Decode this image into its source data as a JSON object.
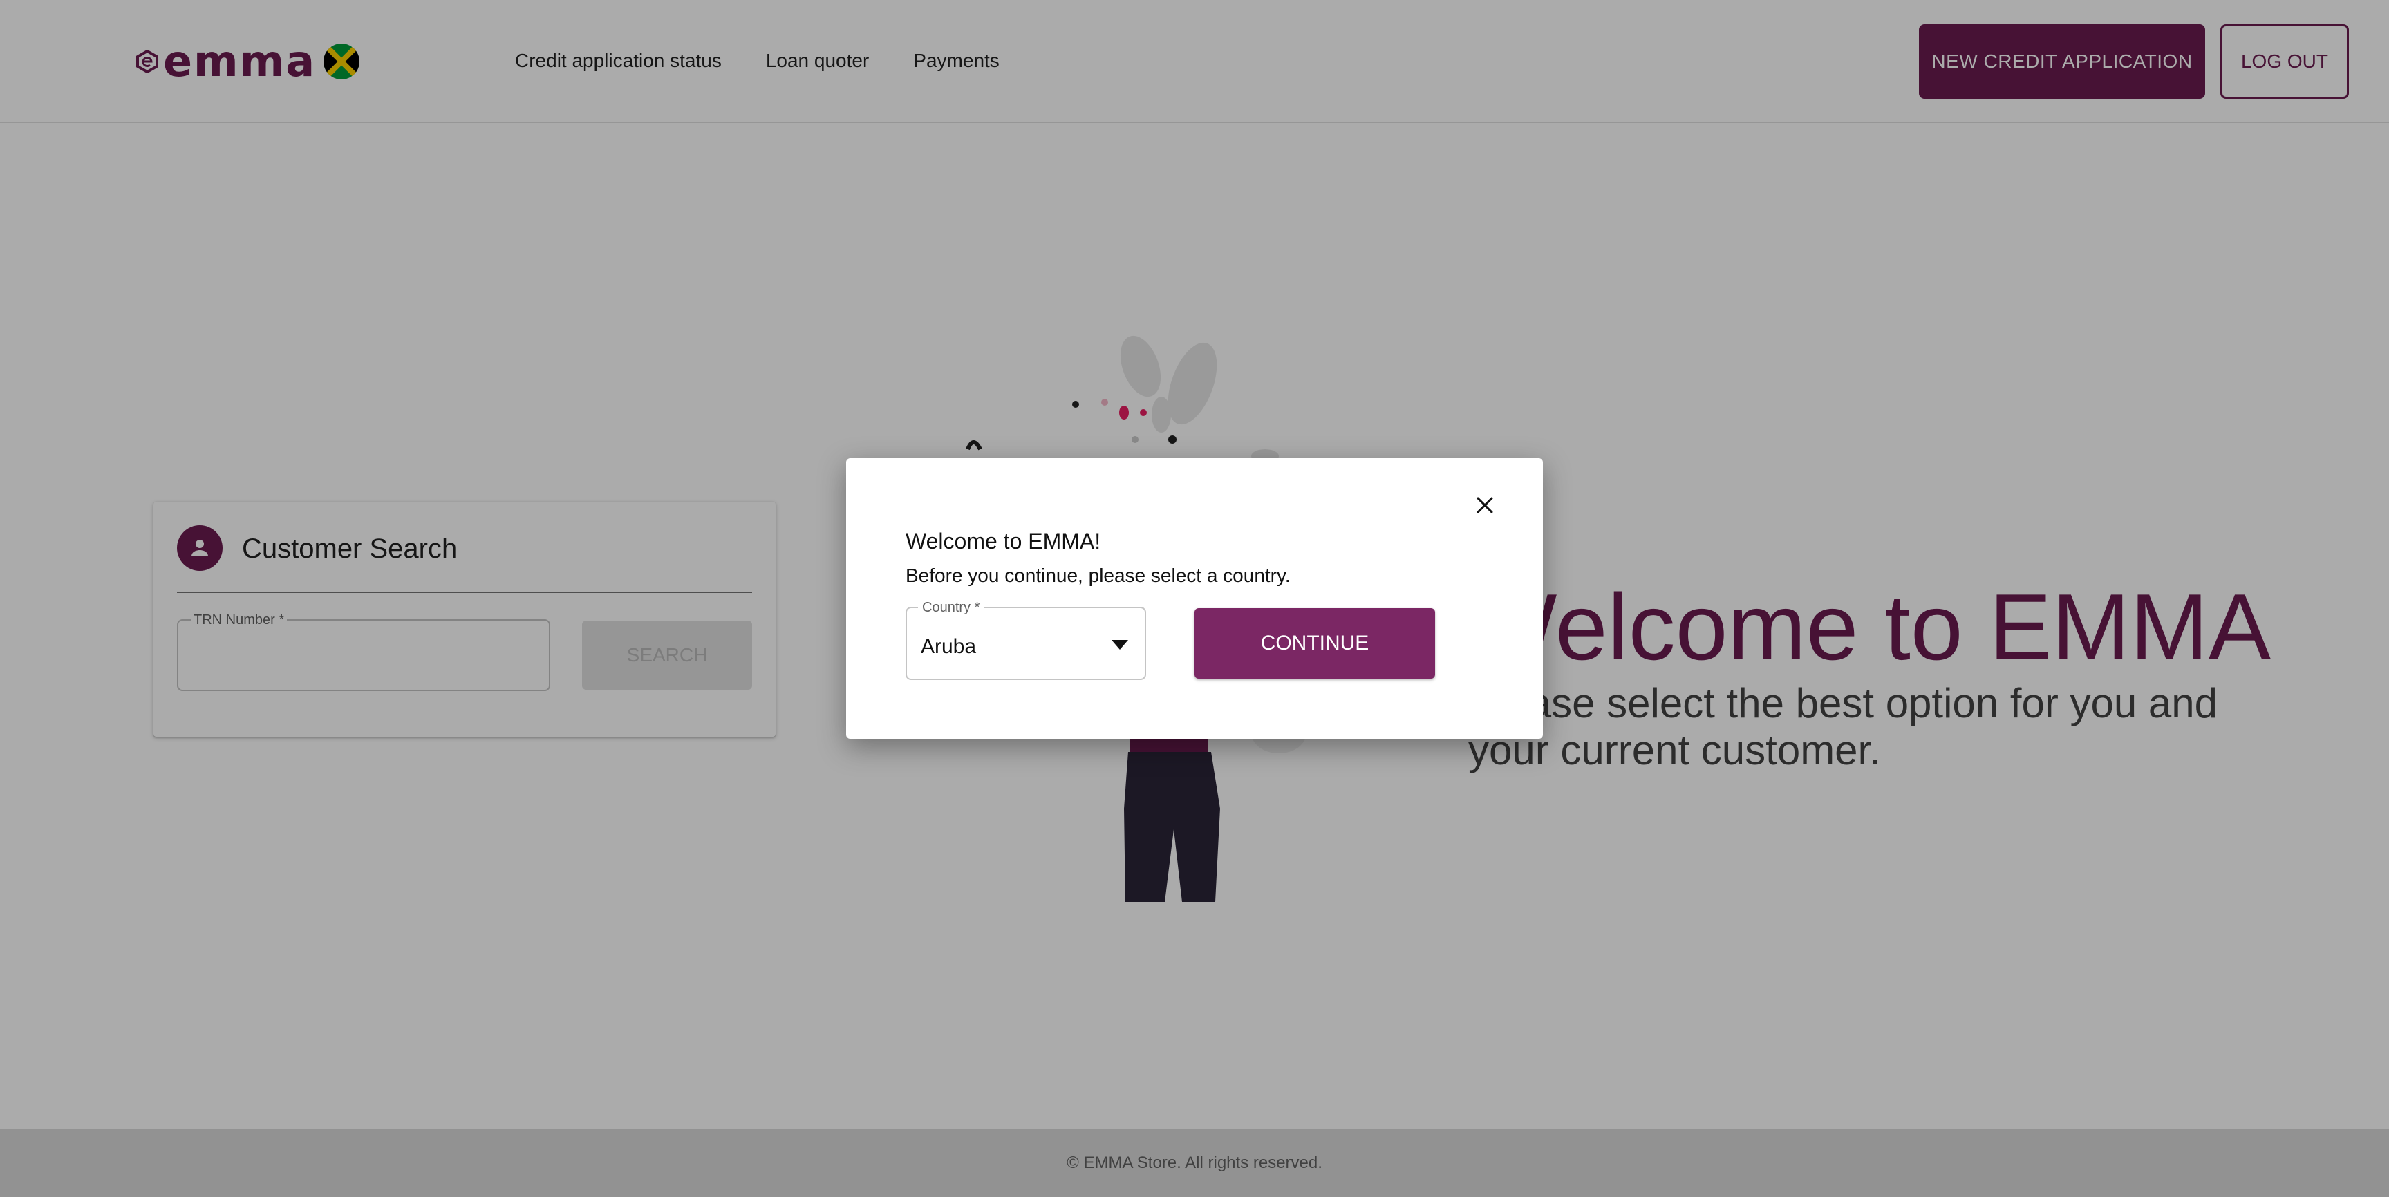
{
  "header": {
    "logo_text": "emma",
    "flag_icon": "jamaica-flag-icon",
    "nav": [
      {
        "label": "Credit application status"
      },
      {
        "label": "Loan quoter"
      },
      {
        "label": "Payments"
      }
    ],
    "new_application_label": "NEW CREDIT APPLICATION",
    "logout_label": "LOG OUT"
  },
  "search": {
    "title": "Customer Search",
    "avatar_icon": "person-icon",
    "trn_label": "TRN Number *",
    "trn_value": "",
    "button_label": "SEARCH"
  },
  "hero": {
    "title": "Welcome to EMMA",
    "subtitle": "Please select the best option for you and your current customer."
  },
  "footer": {
    "text": "© EMMA Store. All rights reserved."
  },
  "dialog": {
    "title": "Welcome to EMMA!",
    "subtitle": "Before you continue, please select a country.",
    "country_label": "Country *",
    "country_value": "Aruba",
    "continue_label": "CONTINUE",
    "close_icon": "close-icon"
  },
  "colors": {
    "brand": "#6a1b50",
    "brand_button": "#7b2764",
    "backdrop": "rgba(0,0,0,0.33)"
  }
}
